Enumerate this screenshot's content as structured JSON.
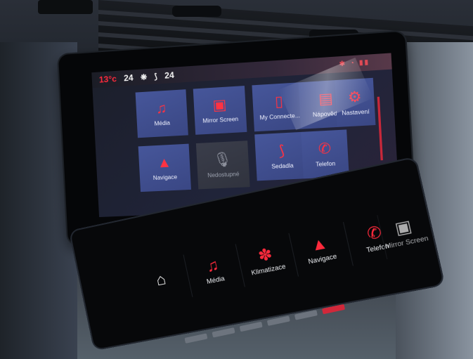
{
  "status_bar": {
    "outside_temp": "13°c",
    "left_temp": "24",
    "fan_icon": "fan-icon",
    "seat_icon": "seat-icon",
    "right_temp": "24",
    "status_icons": "bluetooth wifi signal"
  },
  "tiles": [
    {
      "label": "Média",
      "icon": "music-note-icon",
      "glyph": "♫",
      "state": "active"
    },
    {
      "label": "Mirror Screen",
      "icon": "mirror-screen-icon",
      "glyph": "▣",
      "state": "active"
    },
    {
      "label": "My Connecte...",
      "icon": "phone-app-icon",
      "glyph": "▯",
      "state": "active"
    },
    {
      "label": "Nápověda",
      "icon": "help-icon",
      "glyph": "▤",
      "state": "active"
    },
    {
      "label": "Nastavení",
      "icon": "gear-icon",
      "glyph": "⚙",
      "state": "active"
    },
    {
      "label": "Navigace",
      "icon": "navigation-arrow-icon",
      "glyph": "▲",
      "state": "active"
    },
    {
      "label": "Nedostupné",
      "icon": "microphone-icon",
      "glyph": "🎙",
      "state": "disabled"
    },
    {
      "label": "Sedadla",
      "icon": "seat-icon",
      "glyph": "♿",
      "state": "active"
    },
    {
      "label": "Telefon",
      "icon": "phone-icon",
      "glyph": "✆",
      "state": "active"
    }
  ],
  "touchbar": [
    {
      "label": "",
      "icon": "home-icon",
      "glyph": "⌂"
    },
    {
      "label": "Média",
      "icon": "music-note-icon",
      "glyph": "♫"
    },
    {
      "label": "Klimatizace",
      "icon": "climate-fan-icon",
      "glyph": "✽"
    },
    {
      "label": "Navigace",
      "icon": "navigation-arrow-icon",
      "glyph": "▲"
    },
    {
      "label": "Telefon",
      "icon": "phone-icon",
      "glyph": "✆"
    },
    {
      "label": "Mirror Screen",
      "icon": "mirror-screen-icon",
      "glyph": "▣"
    }
  ],
  "colors": {
    "accent": "#ff2a3c",
    "tile": "#3f4d8f",
    "tile_disabled": "#353845"
  }
}
